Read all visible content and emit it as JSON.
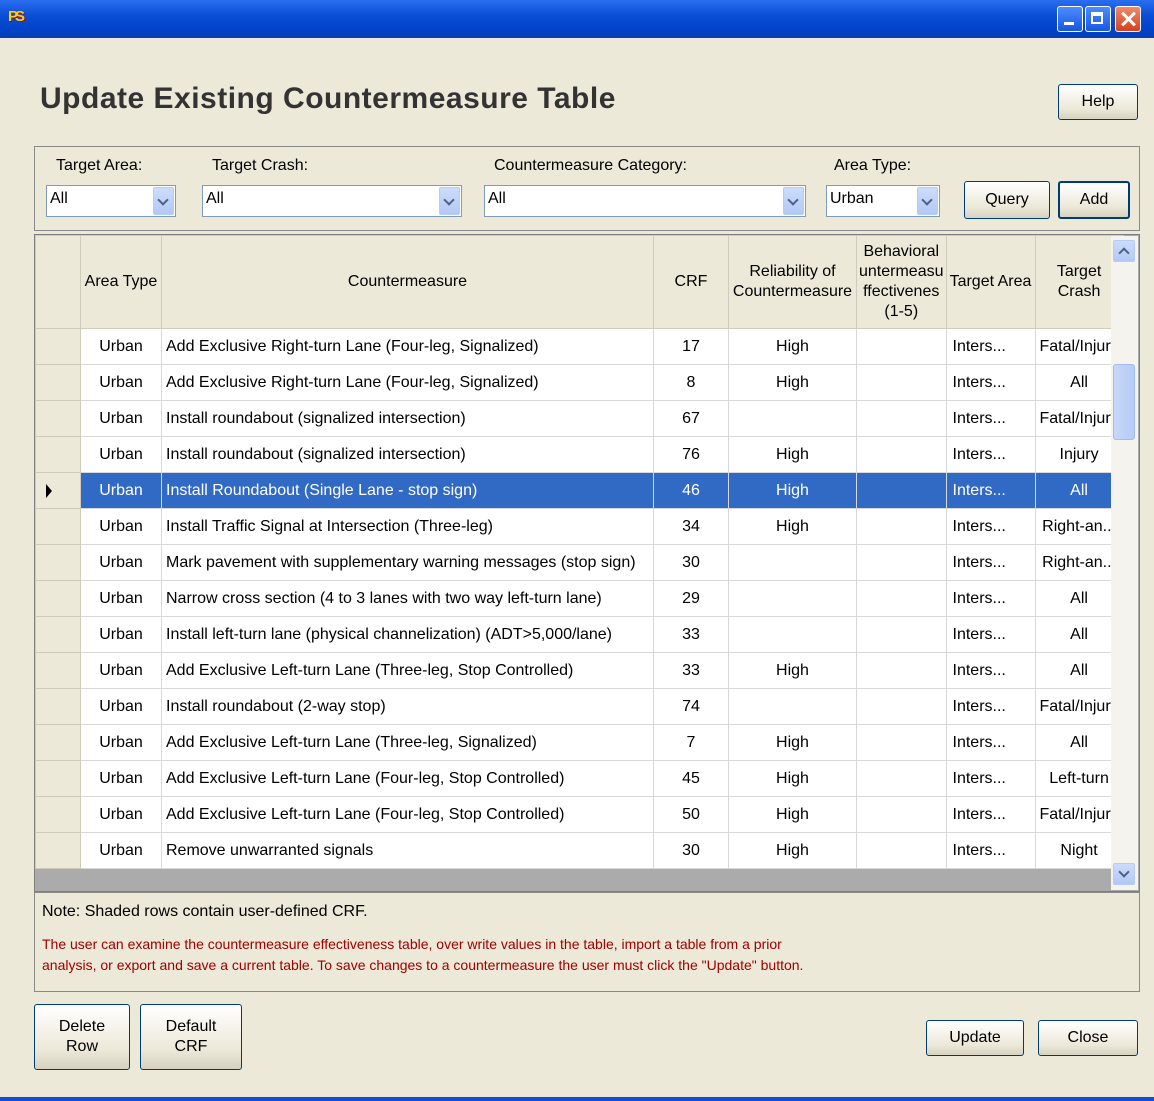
{
  "window": {
    "app_icon": "PS",
    "title": "Update Existing Countermeasure Table",
    "help_label": "Help"
  },
  "filters": {
    "target_area": {
      "label": "Target Area:",
      "value": "All"
    },
    "target_crash": {
      "label": "Target Crash:",
      "value": "All"
    },
    "category": {
      "label": "Countermeasure Category:",
      "value": "All"
    },
    "area_type": {
      "label": "Area Type:",
      "value": "Urban"
    },
    "query_label": "Query",
    "add_label": "Add"
  },
  "table": {
    "headers": {
      "area_type": "Area Type",
      "countermeasure": "Countermeasure",
      "crf": "CRF",
      "reliability": "Reliability of Countermeasure",
      "behavioral": "Behavioral untermeasu ffectivenes (1-5)",
      "target_area": "Target Area",
      "target_crash": "Target Crash"
    },
    "rows": [
      [
        "Urban",
        "Add Exclusive Right-turn Lane (Four-leg, Signalized)",
        "17",
        "High",
        "",
        "Inters...",
        "Fatal/Injury"
      ],
      [
        "Urban",
        "Add Exclusive Right-turn Lane (Four-leg, Signalized)",
        "8",
        "High",
        "",
        "Inters...",
        "All"
      ],
      [
        "Urban",
        "Install roundabout (signalized intersection)",
        "67",
        "",
        "",
        "Inters...",
        "Fatal/Injury"
      ],
      [
        "Urban",
        "Install roundabout (signalized intersection)",
        "76",
        "High",
        "",
        "Inters...",
        "Injury"
      ],
      [
        "Urban",
        "Install Roundabout (Single Lane - stop sign)",
        "46",
        "High",
        "",
        "Inters...",
        "All"
      ],
      [
        "Urban",
        "Install Traffic Signal at Intersection (Three-leg)",
        "34",
        "High",
        "",
        "Inters...",
        "Right-an..."
      ],
      [
        "Urban",
        "Mark pavement with supplementary warning messages (stop sign)",
        "30",
        "",
        "",
        "Inters...",
        "Right-an..."
      ],
      [
        "Urban",
        "Narrow cross section (4 to 3 lanes with two way left-turn lane)",
        "29",
        "",
        "",
        "Inters...",
        "All"
      ],
      [
        "Urban",
        "Install left-turn lane (physical channelization) (ADT>5,000/lane)",
        "33",
        "",
        "",
        "Inters...",
        "All"
      ],
      [
        "Urban",
        "Add Exclusive Left-turn Lane (Three-leg, Stop Controlled)",
        "33",
        "High",
        "",
        "Inters...",
        "All"
      ],
      [
        "Urban",
        "Install roundabout (2-way stop)",
        "74",
        "",
        "",
        "Inters...",
        "Fatal/Injury"
      ],
      [
        "Urban",
        "Add Exclusive Left-turn Lane (Three-leg, Signalized)",
        "7",
        "High",
        "",
        "Inters...",
        "All"
      ],
      [
        "Urban",
        "Add Exclusive Left-turn Lane (Four-leg, Stop Controlled)",
        "45",
        "High",
        "",
        "Inters...",
        "Left-turn"
      ],
      [
        "Urban",
        "Add Exclusive Left-turn Lane (Four-leg, Stop Controlled)",
        "50",
        "High",
        "",
        "Inters...",
        "Fatal/Injury"
      ],
      [
        "Urban",
        "Remove unwarranted signals",
        "30",
        "High",
        "",
        "Inters...",
        "Night"
      ]
    ],
    "selected_row": 4
  },
  "notes": {
    "shaded": "Note: Shaded rows contain user-defined CRF.",
    "info_line1": "The user can examine the countermeasure effectiveness table, over write values in the table, import a table from a prior",
    "info_line2": "analysis, or export and save a current table. To save changes to a countermeasure the user must click the \"Update\" button."
  },
  "actions": {
    "delete_row": [
      "Delete",
      "Row"
    ],
    "default_crf": [
      "Default",
      "CRF"
    ],
    "update": "Update",
    "close": "Close"
  },
  "colors": {
    "selection": "#316ac5",
    "info_text": "#a00000",
    "titlebar": "#0a4fd6"
  }
}
